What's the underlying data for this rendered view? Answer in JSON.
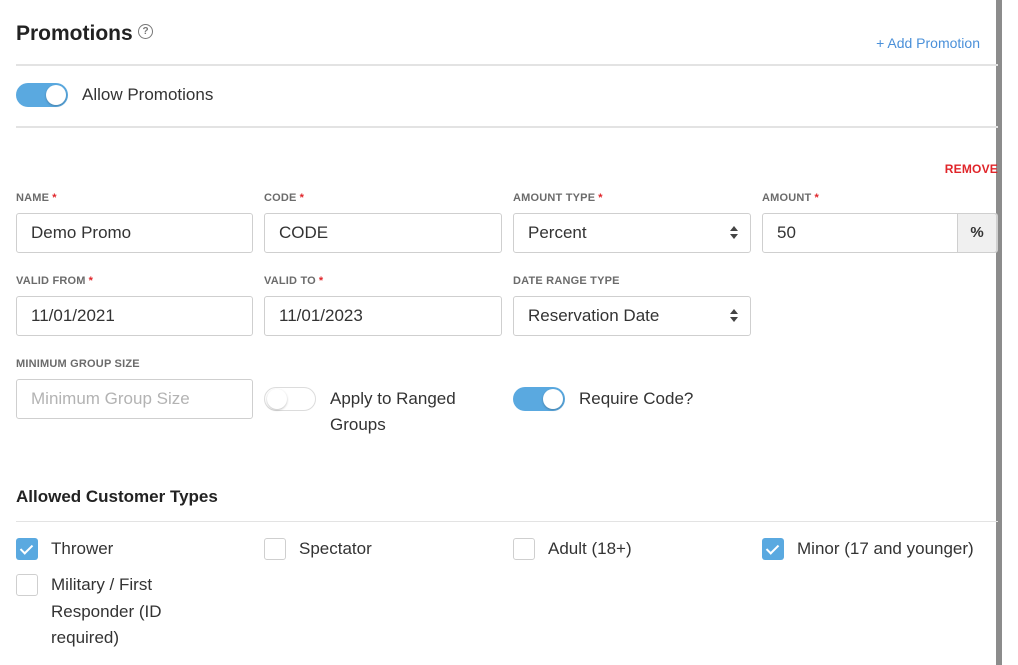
{
  "header": {
    "title": "Promotions",
    "help_icon": "?",
    "add_label": "+ Add Promotion"
  },
  "allow_toggle": {
    "label": "Allow Promotions",
    "on": true
  },
  "promo": {
    "remove_label": "REMOVE",
    "required_mark": "*",
    "name": {
      "label": "NAME",
      "value": "Demo Promo"
    },
    "code": {
      "label": "CODE",
      "value": "CODE"
    },
    "amount_type": {
      "label": "AMOUNT TYPE",
      "value": "Percent"
    },
    "amount": {
      "label": "AMOUNT",
      "value": "50",
      "unit": "%"
    },
    "valid_from": {
      "label": "VALID FROM",
      "value": "11/01/2021"
    },
    "valid_to": {
      "label": "VALID TO",
      "value": "11/01/2023"
    },
    "date_range_type": {
      "label": "DATE RANGE TYPE",
      "value": "Reservation Date"
    },
    "min_group": {
      "label": "MINIMUM GROUP SIZE",
      "value": "",
      "placeholder": "Minimum Group Size"
    },
    "apply_ranged": {
      "label_line1": "Apply to Ranged",
      "label_line2": "Groups",
      "on": false
    },
    "require_code": {
      "label": "Require Code?",
      "on": true
    }
  },
  "customer_types": {
    "title": "Allowed Customer Types",
    "items": [
      {
        "label": "Thrower",
        "checked": true
      },
      {
        "label": "Spectator",
        "checked": false
      },
      {
        "label": "Adult (18+)",
        "checked": false
      },
      {
        "label": "Minor (17 and younger)",
        "checked": true
      },
      {
        "label_lines": [
          "Military / First",
          "Responder (ID",
          "required)"
        ],
        "checked": false
      }
    ]
  },
  "colors": {
    "accent": "#5aa9e0",
    "link": "#4a90d9",
    "danger": "#e0252a"
  }
}
